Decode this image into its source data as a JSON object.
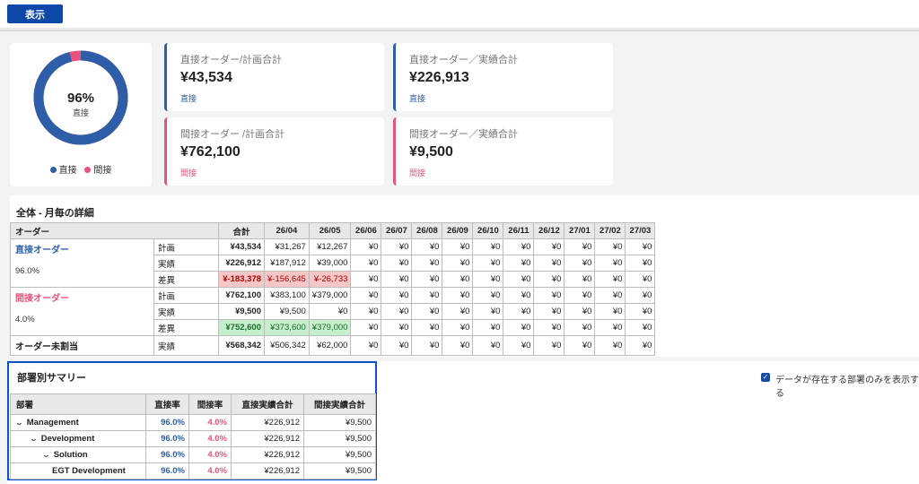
{
  "toolbar": {
    "show_label": "表示"
  },
  "donut": {
    "percent_label": "96%",
    "center_label": "直接",
    "direct_fraction": 0.96,
    "legend": [
      {
        "label": "直接",
        "color": "#2f5ea8"
      },
      {
        "label": "間接",
        "color": "#e8537a"
      }
    ]
  },
  "kpis": [
    {
      "title": "直接オーダー/計画合計",
      "value": "¥43,534",
      "sub": "直接"
    },
    {
      "title": "直接オーダー／実績合計",
      "value": "¥226,913",
      "sub": "直接"
    },
    {
      "title": "間接オーダー /計画合計",
      "value": "¥762,100",
      "sub": "間接"
    },
    {
      "title": "間接オーダー／実績合計",
      "value": "¥9,500",
      "sub": "間接"
    }
  ],
  "monthly": {
    "title": "全体 - 月毎の詳細",
    "col_order": "オーダー",
    "col_total": "合計",
    "months": [
      "26/04",
      "26/05",
      "26/06",
      "26/07",
      "26/08",
      "26/09",
      "26/10",
      "26/11",
      "26/12",
      "27/01",
      "27/02",
      "27/03"
    ],
    "groups": [
      {
        "name": "直接オーダー",
        "pct": "96.0%",
        "rows": [
          {
            "label": "計画",
            "total": "¥43,534",
            "values": [
              "¥31,267",
              "¥12,267",
              "¥0",
              "¥0",
              "¥0",
              "¥0",
              "¥0",
              "¥0",
              "¥0",
              "¥0",
              "¥0",
              "¥0"
            ]
          },
          {
            "label": "実績",
            "total": "¥226,912",
            "values": [
              "¥187,912",
              "¥39,000",
              "¥0",
              "¥0",
              "¥0",
              "¥0",
              "¥0",
              "¥0",
              "¥0",
              "¥0",
              "¥0",
              "¥0"
            ]
          },
          {
            "label": "差異",
            "total": "¥-183,378",
            "values": [
              "¥-156,645",
              "¥-26,733",
              "¥0",
              "¥0",
              "¥0",
              "¥0",
              "¥0",
              "¥0",
              "¥0",
              "¥0",
              "¥0",
              "¥0"
            ]
          }
        ]
      },
      {
        "name": "間接オーダー",
        "pct": "4.0%",
        "rows": [
          {
            "label": "計画",
            "total": "¥762,100",
            "values": [
              "¥383,100",
              "¥379,000",
              "¥0",
              "¥0",
              "¥0",
              "¥0",
              "¥0",
              "¥0",
              "¥0",
              "¥0",
              "¥0",
              "¥0"
            ]
          },
          {
            "label": "実績",
            "total": "¥9,500",
            "values": [
              "¥9,500",
              "¥0",
              "¥0",
              "¥0",
              "¥0",
              "¥0",
              "¥0",
              "¥0",
              "¥0",
              "¥0",
              "¥0",
              "¥0"
            ]
          },
          {
            "label": "差異",
            "total": "¥752,600",
            "values": [
              "¥373,600",
              "¥379,000",
              "¥0",
              "¥0",
              "¥0",
              "¥0",
              "¥0",
              "¥0",
              "¥0",
              "¥0",
              "¥0",
              "¥0"
            ]
          }
        ]
      },
      {
        "name": "オーダー未割当",
        "pct": "",
        "rows": [
          {
            "label": "実績",
            "total": "¥568,342",
            "values": [
              "¥506,342",
              "¥62,000",
              "¥0",
              "¥0",
              "¥0",
              "¥0",
              "¥0",
              "¥0",
              "¥0",
              "¥0",
              "¥0",
              "¥0"
            ]
          }
        ]
      }
    ]
  },
  "summary": {
    "title": "部署別サマリー",
    "checkbox_label": "データが存在する部署のみを表示する",
    "headers": [
      "部署",
      "直接率",
      "間接率",
      "直接実績合計",
      "間接実績合計"
    ],
    "rows": [
      {
        "name": "Management",
        "direct": "96.0%",
        "indirect": "4.0%",
        "direct_total": "¥226,912",
        "indirect_total": "¥9,500"
      },
      {
        "name": "Development",
        "direct": "96.0%",
        "indirect": "4.0%",
        "direct_total": "¥226,912",
        "indirect_total": "¥9,500"
      },
      {
        "name": "Solution",
        "direct": "96.0%",
        "indirect": "4.0%",
        "direct_total": "¥226,912",
        "indirect_total": "¥9,500"
      },
      {
        "name": "EGT Development",
        "direct": "96.0%",
        "indirect": "4.0%",
        "direct_total": "¥226,912",
        "indirect_total": "¥9,500"
      }
    ]
  }
}
